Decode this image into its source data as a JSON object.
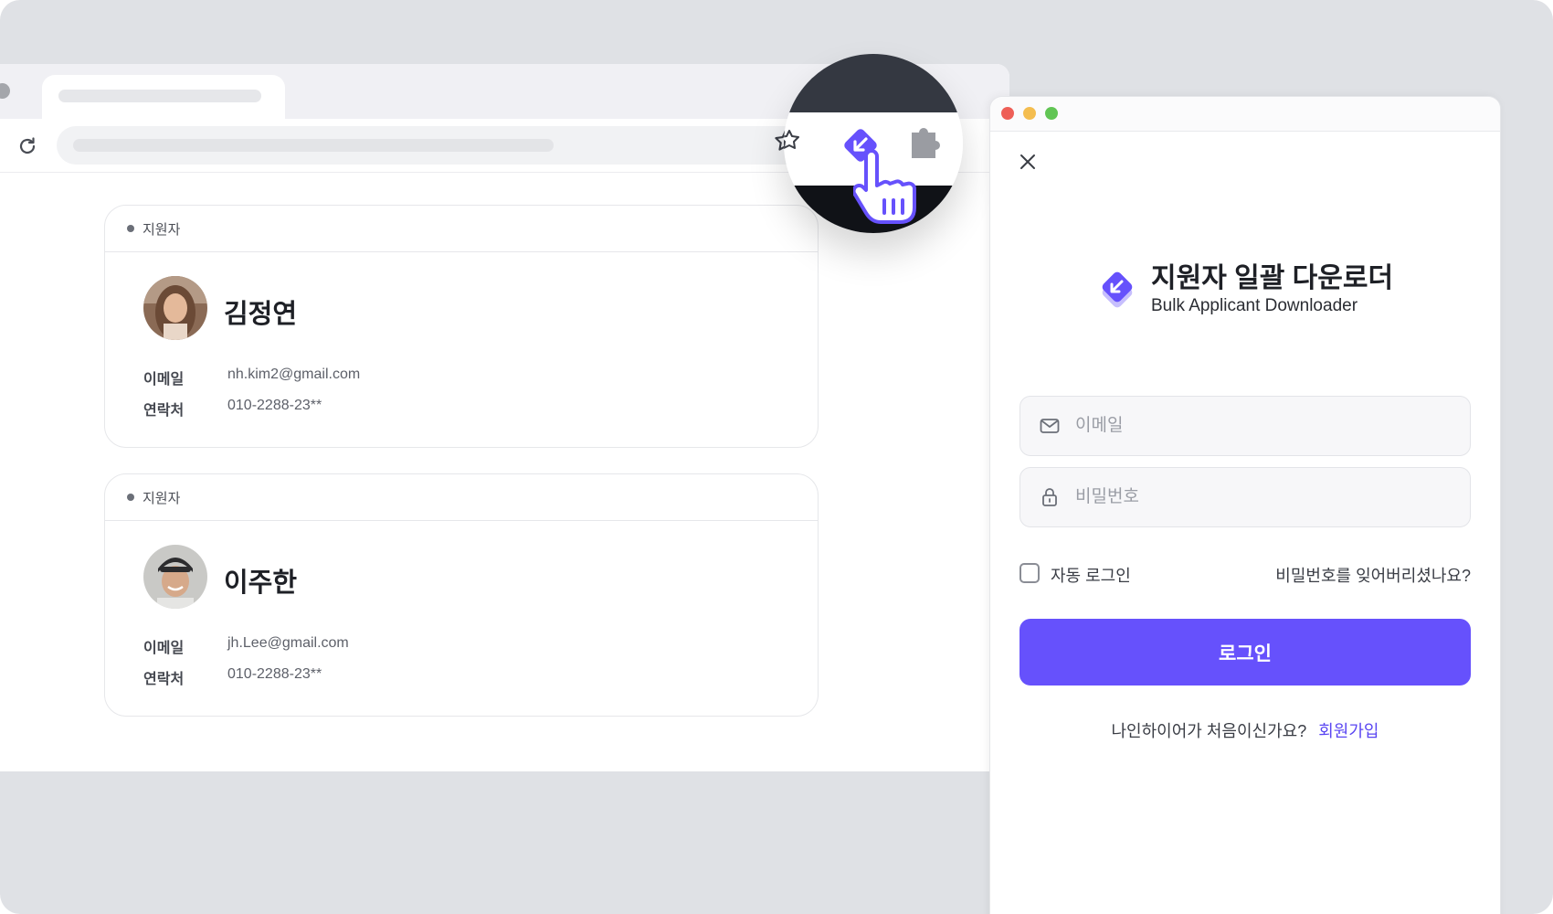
{
  "colors": {
    "accent": "#6651fc",
    "background": "#dfe1e5",
    "link": "#5a46f2"
  },
  "browser": {
    "icons": {
      "reload": "reload-icon",
      "bookmark": "star-icon",
      "extension": "bulk-downloader-extension-icon",
      "extensions_menu": "puzzle-icon"
    }
  },
  "applicants": [
    {
      "tag": "지원자",
      "name": "김정연",
      "email_label": "이메일",
      "email": "nh.kim2@gmail.com",
      "phone_label": "연락처",
      "phone": "010-2288-23**"
    },
    {
      "tag": "지원자",
      "name": "이주한",
      "email_label": "이메일",
      "email": "jh.Lee@gmail.com",
      "phone_label": "연락처",
      "phone": "010-2288-23**"
    }
  ],
  "extension": {
    "title": "지원자 일괄 다운로더",
    "subtitle": "Bulk Applicant Downloader",
    "email_placeholder": "이메일",
    "password_placeholder": "비밀번호",
    "auto_login": "자동 로그인",
    "forgot_password": "비밀번호를 잊어버리셨나요?",
    "login_button": "로그인",
    "signup_prompt": "나인하이어가 처음이신가요?",
    "signup_link": "회원가입"
  }
}
